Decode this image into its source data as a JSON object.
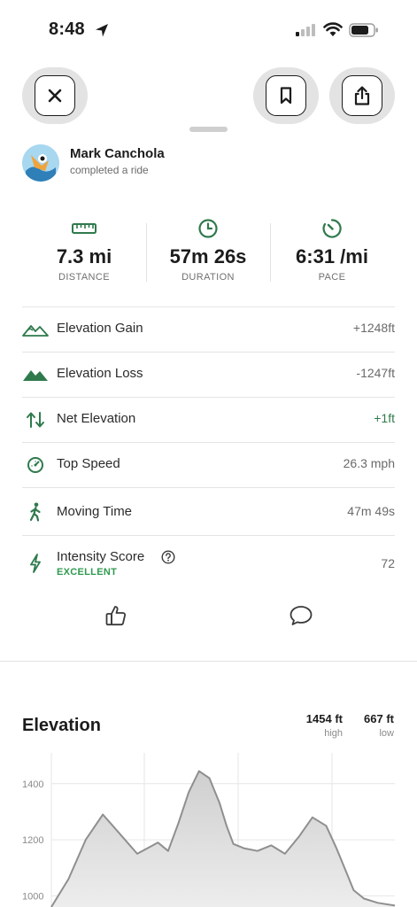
{
  "status_bar": {
    "time": "8:48"
  },
  "header": {
    "close_icon": "close-icon",
    "bookmark_icon": "bookmark-icon",
    "share_icon": "share-icon"
  },
  "user": {
    "name": "Mark Canchola",
    "subtitle": "completed a ride"
  },
  "stats": [
    {
      "icon": "ruler-icon",
      "value": "7.3 mi",
      "label": "DISTANCE"
    },
    {
      "icon": "clock-icon",
      "value": "57m 26s",
      "label": "DURATION"
    },
    {
      "icon": "timer-icon",
      "value": "6:31 /mi",
      "label": "PACE"
    }
  ],
  "metrics": [
    {
      "icon": "mountain-outline-icon",
      "label": "Elevation Gain",
      "value": "+1248ft"
    },
    {
      "icon": "mountain-filled-icon",
      "label": "Elevation Loss",
      "value": "-1247ft"
    },
    {
      "icon": "up-down-arrows-icon",
      "label": "Net Elevation",
      "value": "+1ft"
    },
    {
      "icon": "speedometer-icon",
      "label": "Top Speed",
      "value": "26.3 mph"
    },
    {
      "icon": "walking-icon",
      "label": "Moving Time",
      "value": "47m 49s"
    }
  ],
  "intensity": {
    "icon": "lightning-icon",
    "label": "Intensity Score",
    "rating": "EXCELLENT",
    "value": "72"
  },
  "colors": {
    "accent_green": "#2f7a4c",
    "rating_green": "#2f9a4f",
    "positive_green": "#2f7a4c"
  },
  "elevation": {
    "title": "Elevation",
    "high_value": "1454 ft",
    "high_label": "high",
    "low_value": "667 ft",
    "low_label": "low"
  },
  "chart_data": {
    "type": "area",
    "title": "Elevation",
    "xlabel": "",
    "ylabel": "",
    "y_ticks": [
      "1400",
      "1200",
      "1000"
    ],
    "ylim": [
      960,
      1510
    ],
    "x": [
      0,
      0.05,
      0.1,
      0.15,
      0.2,
      0.25,
      0.28,
      0.31,
      0.34,
      0.37,
      0.4,
      0.43,
      0.46,
      0.49,
      0.51,
      0.53,
      0.56,
      0.6,
      0.64,
      0.68,
      0.72,
      0.76,
      0.8,
      0.83,
      0.86,
      0.88,
      0.91,
      0.95,
      1.0
    ],
    "y": [
      960,
      1060,
      1200,
      1290,
      1220,
      1150,
      1170,
      1190,
      1160,
      1260,
      1370,
      1445,
      1420,
      1330,
      1250,
      1185,
      1170,
      1160,
      1180,
      1150,
      1210,
      1280,
      1250,
      1170,
      1080,
      1020,
      990,
      975,
      965
    ],
    "grid": true,
    "legend": "none"
  }
}
